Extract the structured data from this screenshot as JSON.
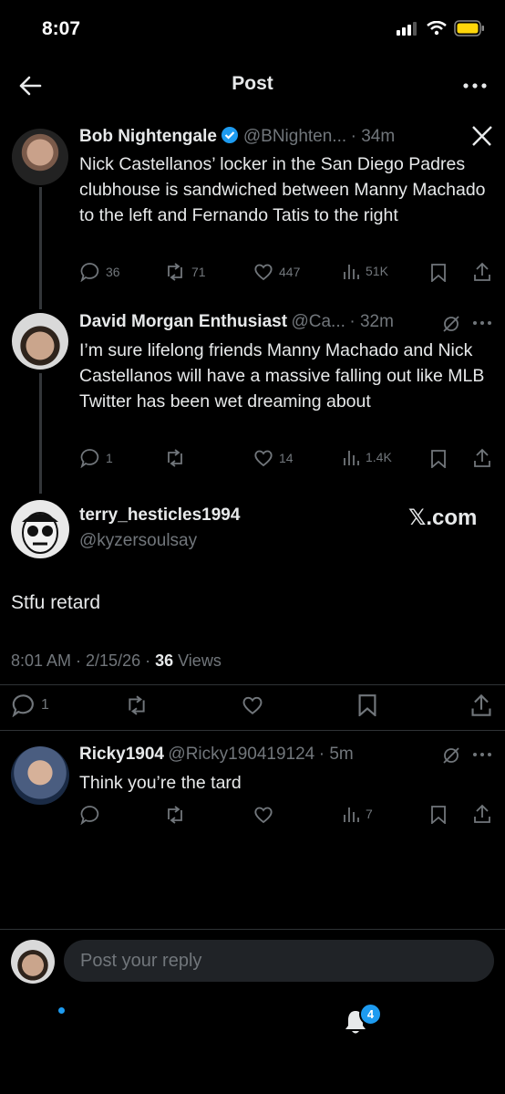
{
  "status": {
    "time": "8:07"
  },
  "header": {
    "title": "Post"
  },
  "tweet1": {
    "name": "Bob Nightengale",
    "handle": "@BNighten...",
    "time": "· 34m",
    "text": "Nick Castellanos’ locker in the San Diego Padres clubhouse is sandwiched between Manny Machado to the left and Fernando Tatis to the right",
    "replies": "36",
    "reposts": "71",
    "likes": "447",
    "views": "51K"
  },
  "tweet2": {
    "name": "David Morgan Enthusiast",
    "handle": "@Ca...",
    "time": "· 32m",
    "text": "I’m sure lifelong friends Manny Machado and Nick Castellanos will have a massive falling out like MLB Twitter has been wet dreaming about",
    "replies": "1",
    "likes": "14",
    "views": "1.4K"
  },
  "main": {
    "name": "terry_hesticles1994",
    "handle": "@kyzersoulsay",
    "watermark": "𝕏.com",
    "text": "Stfu retard",
    "timestamp": "8:01 AM · 2/15/26 · ",
    "views_count": "36",
    "views_label": " Views",
    "replies": "1"
  },
  "reply": {
    "name": "Ricky1904",
    "handle": "@Ricky190419124",
    "time": "· 5m",
    "text": "Think you’re the tard",
    "views": "7"
  },
  "compose": {
    "placeholder": "Post your reply"
  },
  "tabs": {
    "notifications_badge": "4"
  },
  "colors": {
    "accent": "#1d9bf0",
    "muted": "#71767b",
    "battery": "#ffd60a"
  }
}
